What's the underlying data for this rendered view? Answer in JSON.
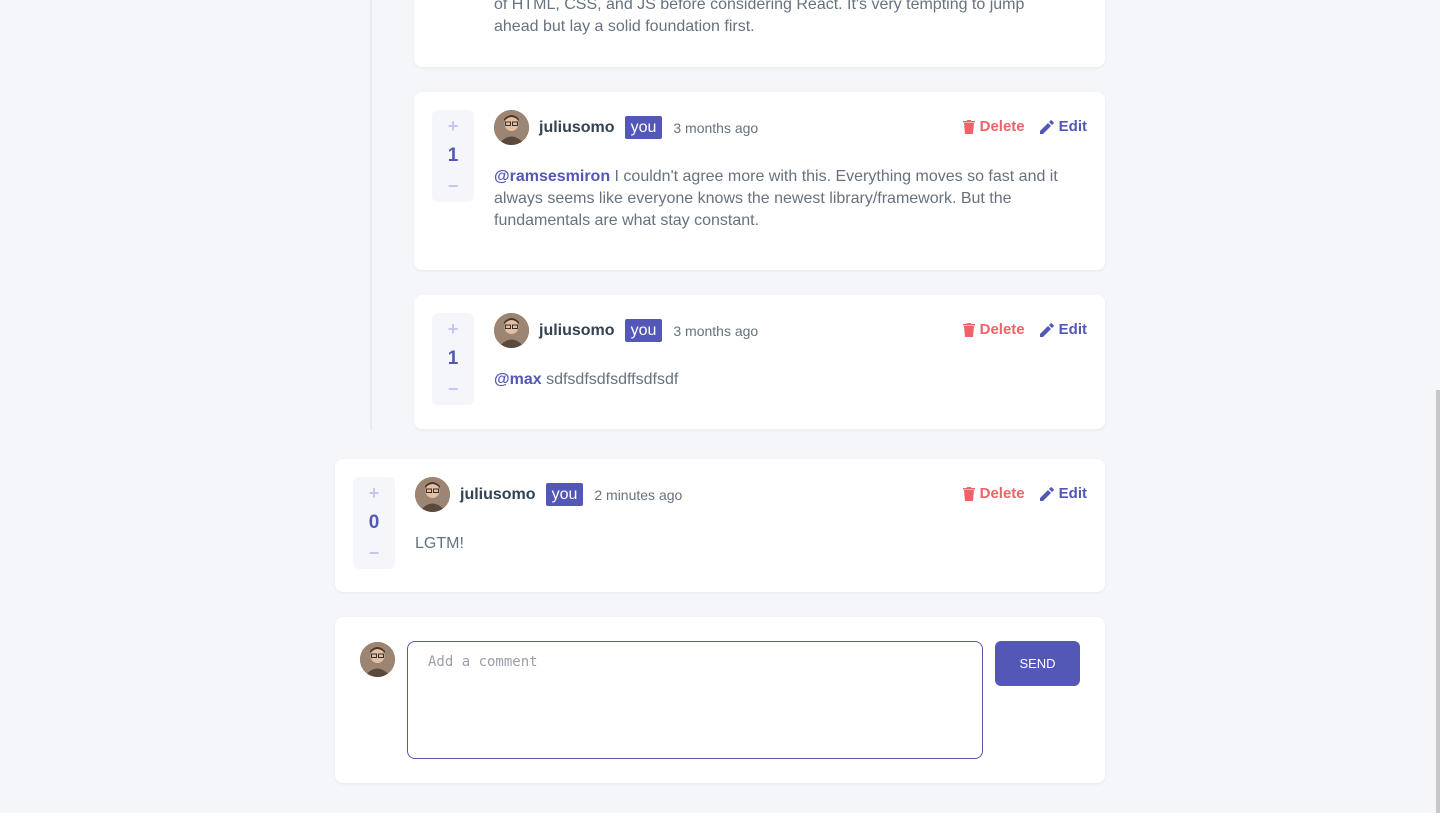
{
  "comments": [
    {
      "partial_text": "ahead but lay a solid foundation first.",
      "partial_text_top": "of HTML, CSS, and JS before considering React. It's very tempting to jump"
    },
    {
      "score": "1",
      "username": "juliusomo",
      "badge": "you",
      "time": "3 months ago",
      "mention": "@ramsesmiron",
      "text": " I couldn't agree more with this. Everything moves so fast and it always seems like everyone knows the newest library/framework. But the fundamentals are what stay constant.",
      "delete_label": "Delete",
      "edit_label": "Edit"
    },
    {
      "score": "1",
      "username": "juliusomo",
      "badge": "you",
      "time": "3 months ago",
      "mention": "@max",
      "text": " sdfsdfsdfsdffsdfsdf",
      "delete_label": "Delete",
      "edit_label": "Edit"
    },
    {
      "score": "0",
      "username": "juliusomo",
      "badge": "you",
      "time": "2 minutes ago",
      "text": "LGTM!",
      "delete_label": "Delete",
      "edit_label": "Edit"
    }
  ],
  "vote": {
    "plus": "+",
    "minus": "−"
  },
  "composer": {
    "placeholder": "Add a comment",
    "send_label": "SEND"
  },
  "colors": {
    "accent": "#5357b6",
    "danger": "#ed6368",
    "background": "#f5f6fa",
    "vote_light": "#c5c6ef"
  },
  "icons": [
    "plus-icon",
    "minus-icon",
    "trash-icon",
    "pencil-icon",
    "avatar"
  ]
}
